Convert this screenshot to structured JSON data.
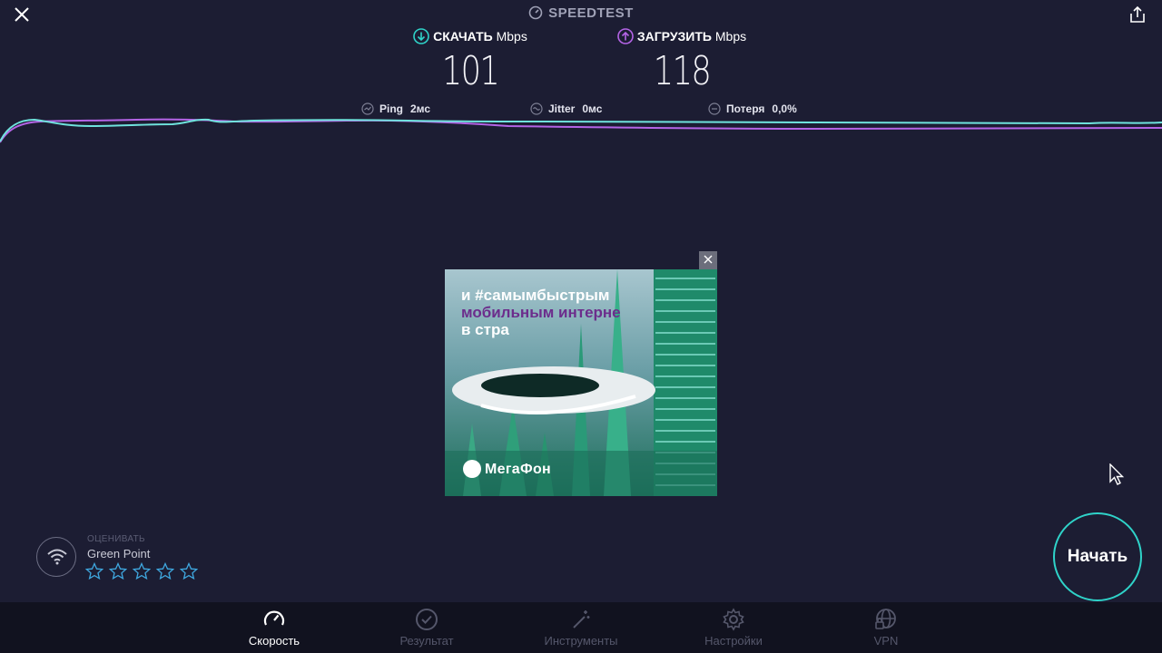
{
  "app": {
    "title": "SPEEDTEST"
  },
  "download": {
    "label": "СКАЧАТЬ",
    "unit": "Mbps",
    "value": "101",
    "color": "#2fd3c9"
  },
  "upload": {
    "label": "ЗАГРУЗИТЬ",
    "unit": "Mbps",
    "value": "118",
    "color": "#b464e6"
  },
  "stats": {
    "ping": {
      "label": "Ping",
      "value": "2мс"
    },
    "jitter": {
      "label": "Jitter",
      "value": "0мс"
    },
    "loss": {
      "label": "Потеря",
      "value": "0,0%"
    }
  },
  "ad": {
    "line1": "и #самымбыстрым",
    "line2": "мобильным интерне",
    "line3": "в стра",
    "brand": "МегаФон",
    "close_icon": "close-icon"
  },
  "rating": {
    "label": "ОЦЕНИВАТЬ",
    "provider": "Green Point",
    "stars": 0,
    "max_stars": 5
  },
  "start_button": {
    "label": "Начать"
  },
  "tabs": [
    {
      "label": "Скорость",
      "icon": "speedometer-icon",
      "active": true
    },
    {
      "label": "Результат",
      "icon": "check-circle-icon",
      "active": false
    },
    {
      "label": "Инструменты",
      "icon": "magic-wand-icon",
      "active": false
    },
    {
      "label": "Настройки",
      "icon": "gear-icon",
      "active": false
    },
    {
      "label": "VPN",
      "icon": "globe-lock-icon",
      "active": false
    }
  ],
  "colors": {
    "background": "#1c1d33",
    "accent": "#2fd3c9",
    "upload_accent": "#b464e6",
    "tabbar": "#11121f"
  }
}
